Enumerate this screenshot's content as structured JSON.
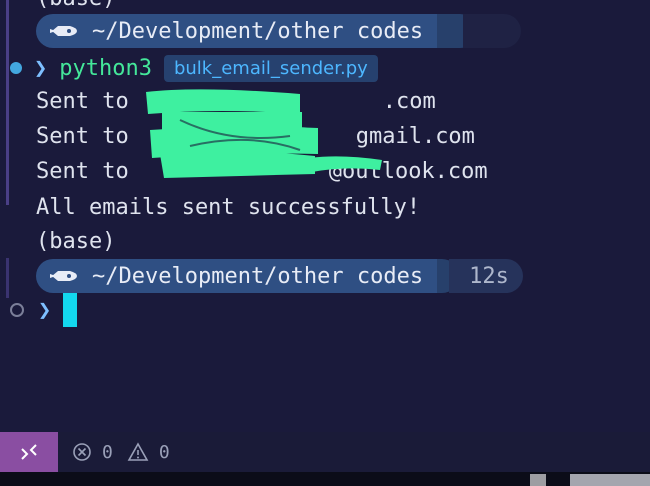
{
  "terminal": {
    "top_partial": "(base)",
    "prompt1": {
      "dir": "~/Development/other codes"
    },
    "command": {
      "cmd": "python3",
      "file": "bulk_email_sender.py"
    },
    "output": [
      {
        "prefix": "Sent to",
        "suffix": ".com"
      },
      {
        "prefix": "Sent to",
        "suffix": "gmail.com"
      },
      {
        "prefix": "Sent to",
        "suffix": "@outlook.com"
      }
    ],
    "success": "All emails sent successfully!",
    "base": "(base)",
    "prompt2": {
      "dir": "~/Development/other codes",
      "duration": "12s"
    }
  },
  "statusbar": {
    "errors": "0",
    "warnings": "0"
  },
  "colors": {
    "background": "#1a1a3b",
    "accent_green": "#44e79a",
    "cursor": "#13d8ee",
    "remote": "#8a4ea2"
  }
}
